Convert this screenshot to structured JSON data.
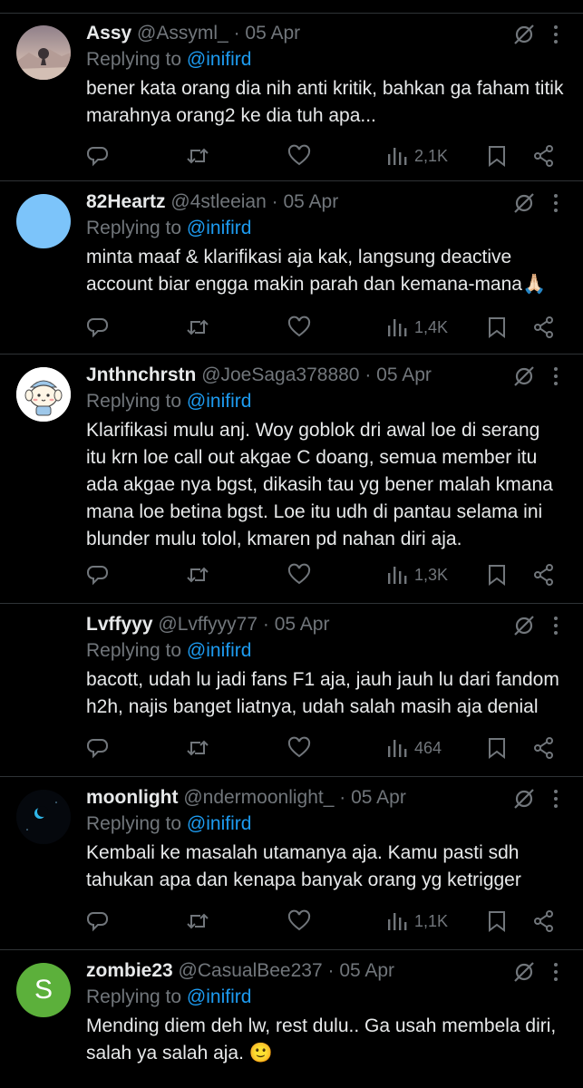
{
  "replies": [
    {
      "name": "Assy",
      "handle": "@Assyml_",
      "sep": "·",
      "date": "05 Apr",
      "replying_prefix": "Replying to",
      "replying_to": "@inifird",
      "text": "bener kata orang dia nih anti kritik, bahkan ga faham titik marahnya orang2 ke dia tuh apa...",
      "views": "2,1K",
      "avatar": "landscape-photo"
    },
    {
      "name": "82Heartz",
      "handle": "@4stleeian",
      "sep": "·",
      "date": "05 Apr",
      "replying_prefix": "Replying to",
      "replying_to": "@inifird",
      "text": "minta maaf & klarifikasi aja kak, langsung deactive account biar engga makin parah dan kemana-mana🙏🏻",
      "views": "1,4K",
      "avatar": "blue-circle"
    },
    {
      "name": "Jnthnchrstn",
      "handle": "@JoeSaga378880",
      "sep": "·",
      "date": "05 Apr",
      "replying_prefix": "Replying to",
      "replying_to": "@inifird",
      "text": "Klarifikasi mulu anj. Woy goblok dri awal loe di serang itu krn loe call out akgae C doang, semua member itu ada akgae nya bgst, dikasih tau yg bener malah kmana mana loe betina bgst. Loe itu udh di pantau selama ini blunder mulu tolol, kmaren pd nahan diri aja.",
      "views": "1,3K",
      "avatar": "cartoon-character"
    },
    {
      "name": "Lvffyyy",
      "handle": "@Lvffyyy77",
      "sep": "·",
      "date": "05 Apr",
      "replying_prefix": "Replying to",
      "replying_to": "@inifird",
      "text": "bacott, udah lu jadi fans F1 aja, jauh jauh lu dari fandom h2h, najis banget liatnya, udah salah masih aja denial",
      "views": "464",
      "avatar": "black"
    },
    {
      "name": "moonlight",
      "handle": "@ndermoonlight_",
      "sep": "·",
      "date": "05 Apr",
      "replying_prefix": "Replying to",
      "replying_to": "@inifird",
      "text": "Kembali ke masalah utamanya aja. Kamu pasti sdh tahukan apa dan kenapa banyak orang yg ketrigger",
      "views": "1,1K",
      "avatar": "night-moon"
    },
    {
      "name": "zombie23",
      "handle": "@CasualBee237",
      "sep": "·",
      "date": "05 Apr",
      "replying_prefix": "Replying to",
      "replying_to": "@inifird",
      "text": "Mending diem deh lw, rest dulu.. Ga usah membela diri, salah ya salah aja. 🙂",
      "views": "",
      "avatar": "letter-avatar",
      "avatar_letter": "S"
    }
  ],
  "colors": {
    "background": "#000000",
    "text": "#e7e9ea",
    "muted": "#71767b",
    "link": "#1d9bf0",
    "divider": "#2f3336",
    "avatar_blue": "#7cc4fa",
    "avatar_green": "#5cb03b"
  }
}
